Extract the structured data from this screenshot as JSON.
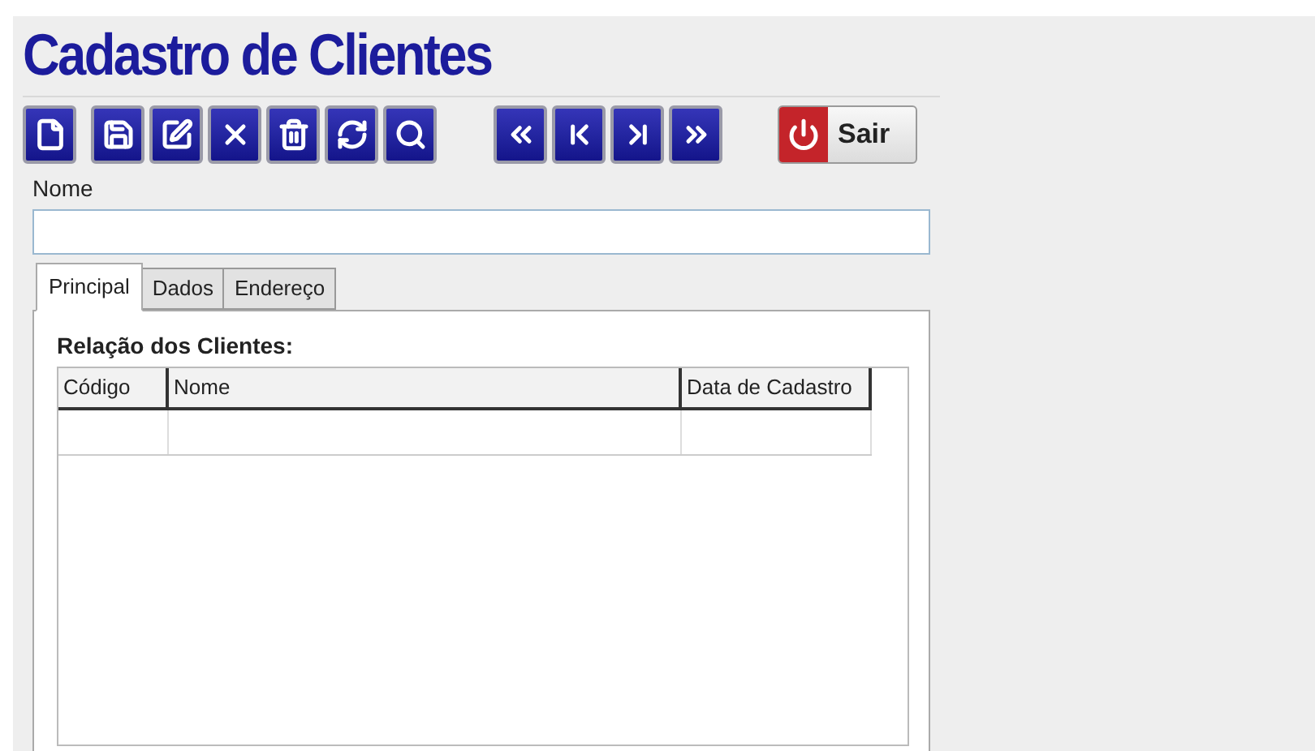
{
  "title": "Cadastro de Clientes",
  "toolbar": {
    "exit_label": "Sair"
  },
  "name_field": {
    "label": "Nome"
  },
  "tabs": [
    {
      "label": "Principal",
      "selected": true
    },
    {
      "label": "Dados",
      "selected": false
    },
    {
      "label": "Endereço",
      "selected": false
    }
  ],
  "clients": {
    "title": "Relação dos Clientes:",
    "columns": [
      "Código",
      "Nome",
      "Data de Cadastro"
    ]
  }
}
